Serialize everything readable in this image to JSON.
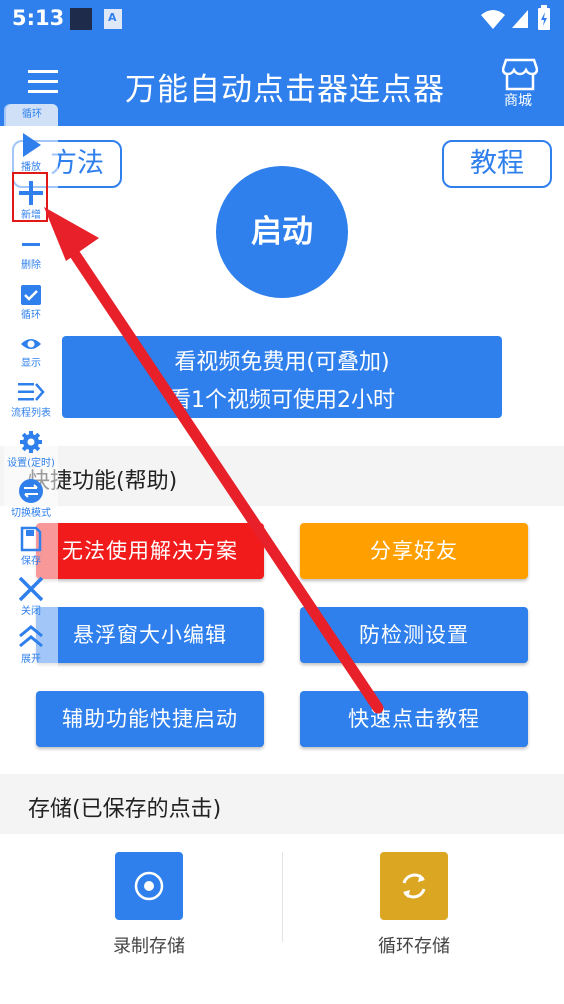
{
  "status_bar": {
    "time": "5:13"
  },
  "app_bar": {
    "title": "万能自动点击器连点器",
    "store_label": "商城"
  },
  "top_buttons": {
    "method": "方法",
    "tutorial": "教程"
  },
  "start_button": "启动",
  "video_button": {
    "line1": "看视频免费用(可叠加)",
    "line2": "看1个视频可使用2小时"
  },
  "quick_section": {
    "title": "快捷功能(帮助)",
    "buttons": [
      "无法使用解决方案",
      "分享好友",
      "悬浮窗大小编辑",
      "防检测设置",
      "辅助功能快捷启动",
      "快速点击教程"
    ]
  },
  "storage_section": {
    "title": "存储(已保存的点击)",
    "items": [
      "录制存储",
      "循环存储"
    ]
  },
  "float_toolbar": {
    "top_label": "循环",
    "items": [
      "播放",
      "新增",
      "删除",
      "循环",
      "显示",
      "流程列表",
      "设置(定时)",
      "切换模式",
      "保存",
      "关闭",
      "展开"
    ]
  },
  "colors": {
    "primary": "#2f80ed",
    "red": "#f21b1b",
    "orange": "#ffa000",
    "gold": "#dba622",
    "arrow": "#e8202a"
  }
}
